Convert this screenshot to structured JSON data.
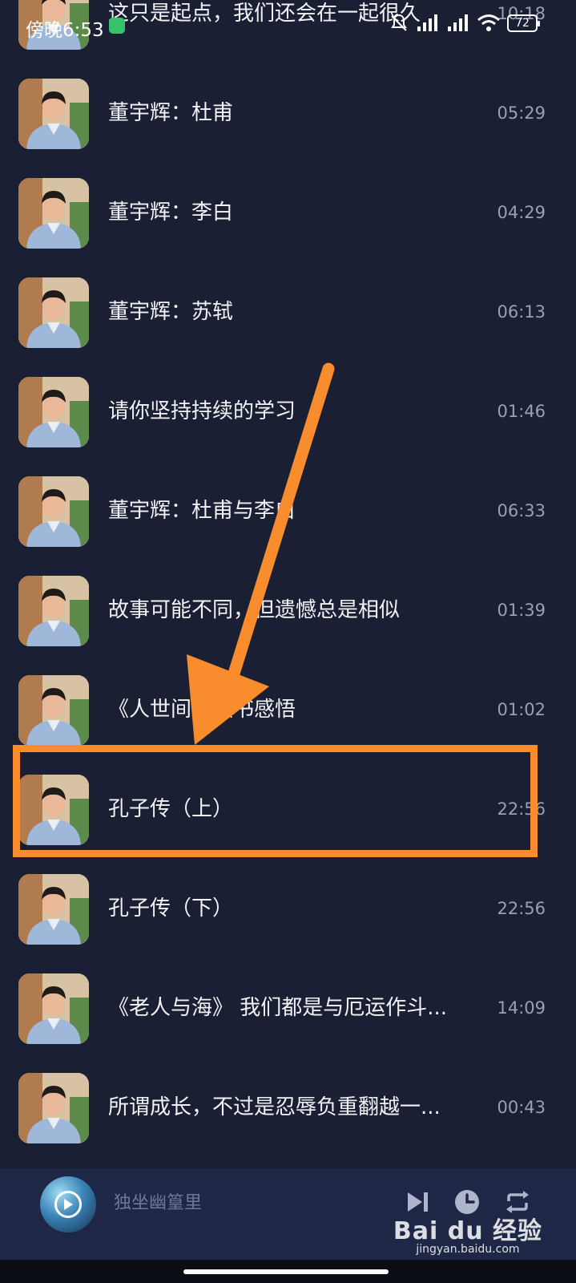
{
  "status_bar": {
    "time": "傍晚6:53",
    "battery": "72"
  },
  "tracks": [
    {
      "title": "这只是起点，我们还会在一起很久",
      "duration": "10:18"
    },
    {
      "title": "董宇辉：杜甫",
      "duration": "05:29"
    },
    {
      "title": "董宇辉：李白",
      "duration": "04:29"
    },
    {
      "title": "董宇辉：苏轼",
      "duration": "06:13"
    },
    {
      "title": "请你坚持持续的学习",
      "duration": "01:46"
    },
    {
      "title": "董宇辉：杜甫与李白",
      "duration": "06:33"
    },
    {
      "title": "故事可能不同，但遗憾总是相似",
      "duration": "01:39"
    },
    {
      "title": "《人世间》读书感悟",
      "duration": "01:02"
    },
    {
      "title": "孔子传（上）",
      "duration": "22:56"
    },
    {
      "title": "孔子传（下）",
      "duration": "22:56"
    },
    {
      "title": "《老人与海》 我们都是与厄运作斗...",
      "duration": "14:09"
    },
    {
      "title": "所谓成长，不过是忍辱负重翻越一...",
      "duration": "00:43"
    }
  ],
  "player": {
    "now_playing": "独坐幽篁里"
  },
  "watermark": {
    "logo": "Bai du 经验",
    "site": "jingyan.baidu.com"
  },
  "colors": {
    "background": "#1a1f33",
    "player_bar": "#1e2746",
    "annotation": "#f98d2e"
  }
}
